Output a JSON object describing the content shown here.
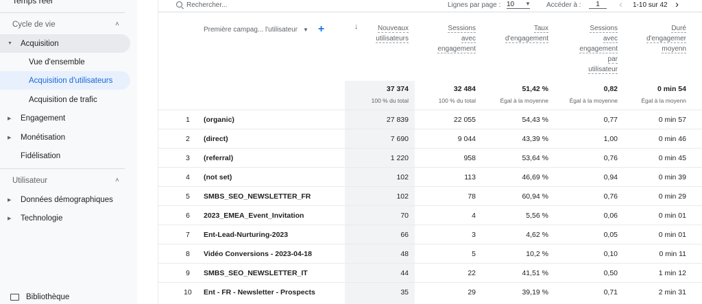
{
  "sidebar": {
    "top_item": "Temps réel",
    "section1": "Cycle de vie",
    "acquisition": "Acquisition",
    "vue_ensemble": "Vue d'ensemble",
    "acq_utilisateurs": "Acquisition d'utilisateurs",
    "acq_trafic": "Acquisition de trafic",
    "engagement": "Engagement",
    "monetisation": "Monétisation",
    "fidelisation": "Fidélisation",
    "section2": "Utilisateur",
    "donnees_demo": "Données démographiques",
    "technologie": "Technologie",
    "bibliotheque": "Bibliothèque"
  },
  "toolbar": {
    "search_placeholder": "Rechercher...",
    "rows_per_page_label": "Lignes par page :",
    "rows_per_page_value": "10",
    "goto_label": "Accéder à :",
    "goto_value": "1",
    "range": "1-10 sur 42"
  },
  "table": {
    "dimension_header": "Première campag... l'utilisateur",
    "columns": [
      {
        "lines": [
          "Nouveaux",
          "utilisateurs"
        ]
      },
      {
        "lines": [
          "Sessions",
          "avec",
          "engagement"
        ]
      },
      {
        "lines": [
          "Taux",
          "d'engagement"
        ]
      },
      {
        "lines": [
          "Sessions",
          "avec",
          "engagement",
          "par",
          "utilisateur"
        ]
      },
      {
        "lines": [
          "Duré",
          "d'engagemer",
          "moyenn"
        ]
      }
    ],
    "totals": [
      {
        "value": "37 374",
        "sub": "100 % du total"
      },
      {
        "value": "32 484",
        "sub": "100 % du total"
      },
      {
        "value": "51,42 %",
        "sub": "Égal à la moyenne"
      },
      {
        "value": "0,82",
        "sub": "Égal à la moyenne"
      },
      {
        "value": "0 min 54",
        "sub": "Égal à la moyenn"
      }
    ],
    "rows": [
      {
        "idx": "1",
        "dim": "(organic)",
        "v": [
          "27 839",
          "22 055",
          "54,43 %",
          "0,77",
          "0 min 57"
        ]
      },
      {
        "idx": "2",
        "dim": "(direct)",
        "v": [
          "7 690",
          "9 044",
          "43,39 %",
          "1,00",
          "0 min 46"
        ]
      },
      {
        "idx": "3",
        "dim": "(referral)",
        "v": [
          "1 220",
          "958",
          "53,64 %",
          "0,76",
          "0 min 45"
        ]
      },
      {
        "idx": "4",
        "dim": "(not set)",
        "v": [
          "102",
          "113",
          "46,69 %",
          "0,94",
          "0 min 39"
        ]
      },
      {
        "idx": "5",
        "dim": "SMBS_SEO_NEWSLETTER_FR",
        "v": [
          "102",
          "78",
          "60,94 %",
          "0,76",
          "0 min 29"
        ]
      },
      {
        "idx": "6",
        "dim": "2023_EMEA_Event_Invitation",
        "v": [
          "70",
          "4",
          "5,56 %",
          "0,06",
          "0 min 01"
        ]
      },
      {
        "idx": "7",
        "dim": "Ent-Lead-Nurturing-2023",
        "v": [
          "66",
          "3",
          "4,62 %",
          "0,05",
          "0 min 01"
        ]
      },
      {
        "idx": "8",
        "dim": "Vidéo Conversions - 2023-04-18",
        "v": [
          "48",
          "5",
          "10,2 %",
          "0,10",
          "0 min 11"
        ]
      },
      {
        "idx": "9",
        "dim": "SMBS_SEO_NEWSLETTER_IT",
        "v": [
          "44",
          "22",
          "41,51 %",
          "0,50",
          "1 min 12"
        ]
      },
      {
        "idx": "10",
        "dim": "Ent - FR - Newsletter - Prospects",
        "v": [
          "35",
          "29",
          "39,19 %",
          "0,71",
          "2 min 31"
        ]
      }
    ]
  }
}
